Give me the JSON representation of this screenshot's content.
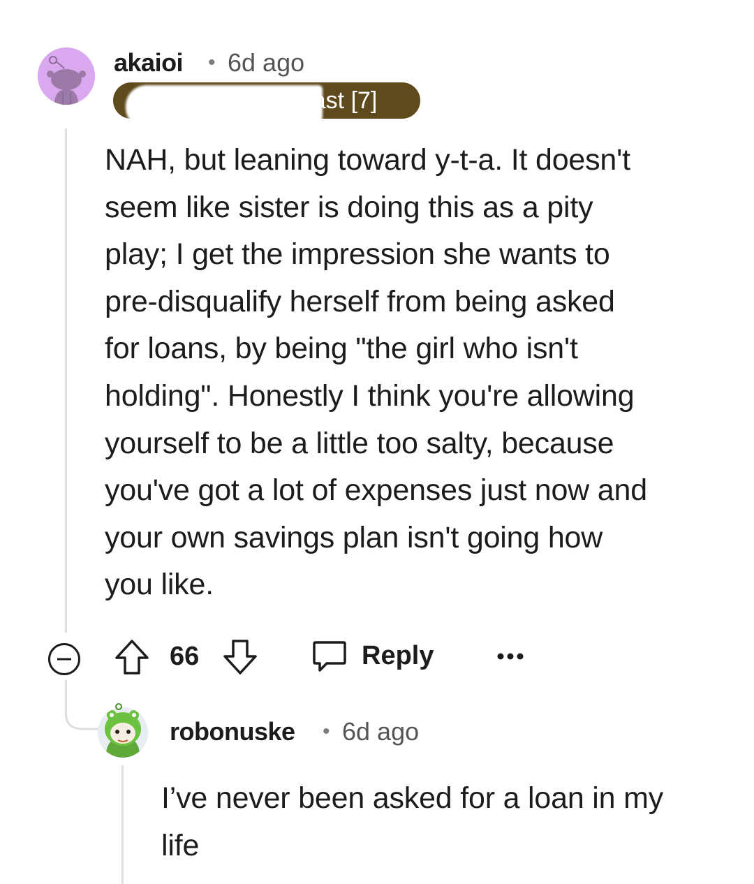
{
  "comment": {
    "username": "akaioi",
    "separator": "•",
    "time": "6d ago",
    "flair": "e Enthusiast [7]",
    "body": "NAH, but leaning toward y-t-a. It doesn't\nseem like sister is doing this as a pity\nplay; I get the impression she wants to\npre-disqualify herself from being asked\nfor loans, by being \"the girl who isn't\nholding\". Honestly I think you're allowing\nyourself to be a little too salty, because\nyou've got a lot of expenses just now and\nyour own savings plan isn't going how\nyou like.",
    "score": "66",
    "reply_label": "Reply",
    "more_label": "•••"
  },
  "reply": {
    "username": "robonuske",
    "separator": "•",
    "time": "6d ago",
    "body": "I’ve never been asked for a loan in my\nlife"
  },
  "colors": {
    "flair_background": "#5f4a1d",
    "avatar_background": "#d9a8ef",
    "thread_line": "#dedede",
    "meta_text": "#555555"
  },
  "icons": {
    "collapse": "collapse-minus-icon",
    "upvote": "upvote-arrow-icon",
    "downvote": "downvote-arrow-icon",
    "reply": "comment-bubble-icon",
    "more": "more-dots-icon"
  }
}
